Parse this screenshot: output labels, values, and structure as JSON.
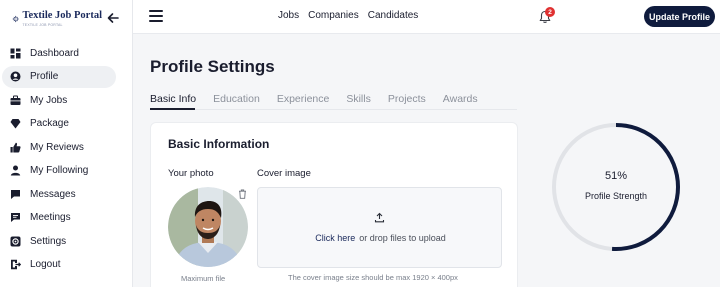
{
  "brand": {
    "title": "Textile Job Portal",
    "tagline": "TEXTILE JOB PORTAL",
    "color": "#1b2a5c"
  },
  "sidebar": {
    "items": [
      {
        "label": "Dashboard",
        "icon": "dashboard-icon"
      },
      {
        "label": "Profile",
        "icon": "user-circle-icon"
      },
      {
        "label": "My Jobs",
        "icon": "briefcase-icon"
      },
      {
        "label": "Package",
        "icon": "diamond-icon"
      },
      {
        "label": "My Reviews",
        "icon": "thumbs-up-icon"
      },
      {
        "label": "My Following",
        "icon": "person-icon"
      },
      {
        "label": "Messages",
        "icon": "chat-icon"
      },
      {
        "label": "Meetings",
        "icon": "flag-message-icon"
      },
      {
        "label": "Settings",
        "icon": "gear-icon"
      },
      {
        "label": "Logout",
        "icon": "logout-icon"
      }
    ],
    "active": "Profile"
  },
  "header": {
    "links": [
      "Jobs",
      "Companies",
      "Candidates"
    ],
    "notification_count": "2",
    "update_button": "Update Profile"
  },
  "main": {
    "title": "Profile Settings",
    "tabs": [
      "Basic Info",
      "Education",
      "Experience",
      "Skills",
      "Projects",
      "Awards"
    ],
    "active_tab": "Basic Info",
    "card": {
      "title": "Basic Information",
      "photo_label": "Your photo",
      "cover_label": "Cover image",
      "max_file_text": "Maximum file",
      "click_here": "Click here",
      "drop_text": "or drop files to upload",
      "cover_hint": "The cover image size should be max 1920 × 400px"
    },
    "strength": {
      "percent_text": "51%",
      "percent_value": 51,
      "label": "Profile Strength"
    }
  },
  "colors": {
    "accent": "#0f1b3d",
    "badge": "#e03131",
    "ring_track": "#e1e3e7"
  }
}
